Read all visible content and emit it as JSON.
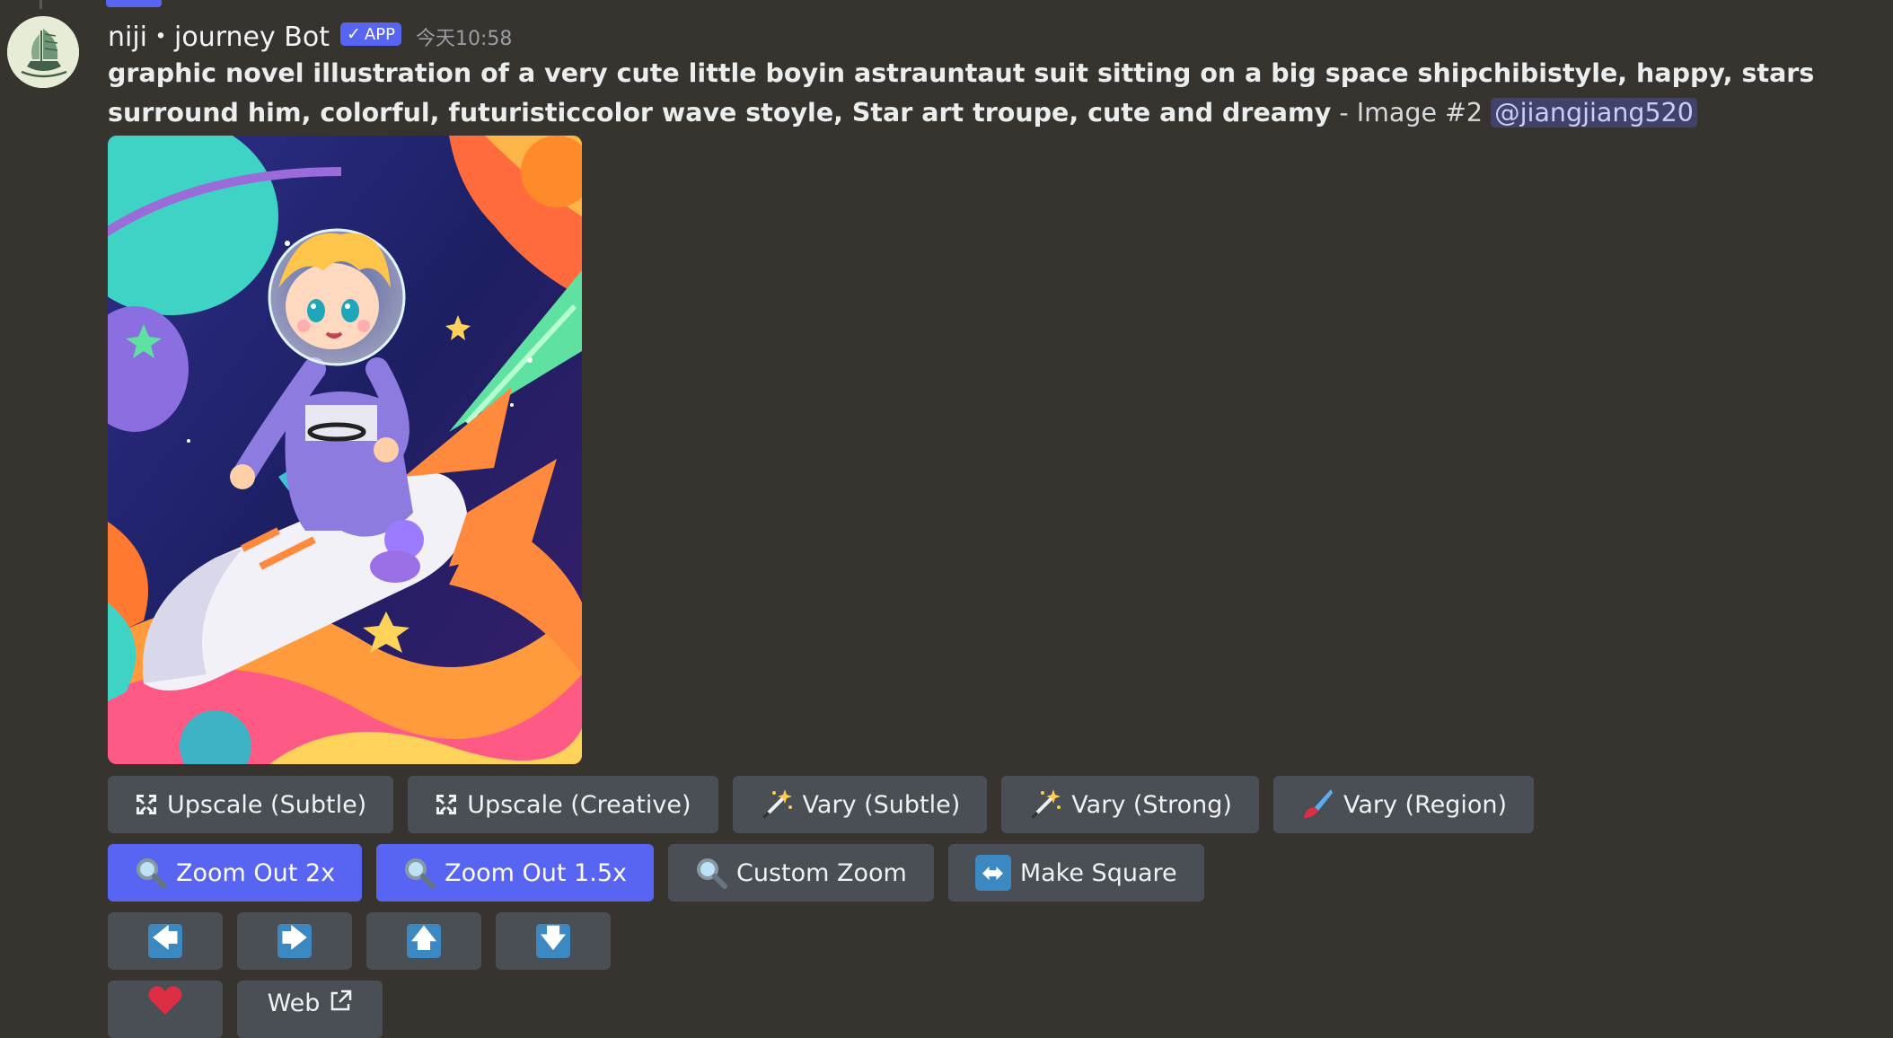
{
  "message": {
    "author": "niji・journey Bot",
    "app_badge": "APP",
    "check_icon": "✓",
    "timestamp": "今天10:58",
    "prompt_bold": "graphic novel illustration of a very cute little boyin astrauntaut suit sitting on a big space shipchibistyle, happy, stars surround him, colorful, futuristiccolor wave stoyle, Star art troupe, cute and dreamy",
    "prompt_suffix": " - Image #2 ",
    "mention": "@jiangjiang520",
    "image_icon": "generated-astronaut-image"
  },
  "buttons": {
    "row1": [
      {
        "label": "Upscale (Subtle)",
        "icon": "expand-icon"
      },
      {
        "label": "Upscale (Creative)",
        "icon": "expand-icon"
      },
      {
        "label": "Vary (Subtle)",
        "icon": "magic-wand-icon"
      },
      {
        "label": "Vary (Strong)",
        "icon": "magic-wand-icon"
      },
      {
        "label": "Vary (Region)",
        "icon": "paintbrush-icon"
      }
    ],
    "row2": [
      {
        "label": "Zoom Out 2x",
        "icon": "magnifier-icon"
      },
      {
        "label": "Zoom Out 1.5x",
        "icon": "magnifier-icon"
      },
      {
        "label": "Custom Zoom",
        "icon": "magnifier-icon"
      },
      {
        "label": "Make Square",
        "icon": "left-right-arrow-icon"
      }
    ],
    "row3": [
      {
        "glyph": "🡄",
        "icon": "arrow-left-icon"
      },
      {
        "glyph": "🡆",
        "icon": "arrow-right-icon"
      },
      {
        "glyph": "🡅",
        "icon": "arrow-up-icon"
      },
      {
        "glyph": "🡇",
        "icon": "arrow-down-icon"
      }
    ],
    "row4": [
      {
        "icon": "heart-icon"
      },
      {
        "label": "Web",
        "icon": "external-link-icon"
      }
    ],
    "make_square_glyph": "⬌"
  },
  "colors": {
    "background": "#37332f",
    "button": "#4a4e55",
    "button_primary": "#5865f2",
    "emoji_box": "#3b88c3"
  }
}
